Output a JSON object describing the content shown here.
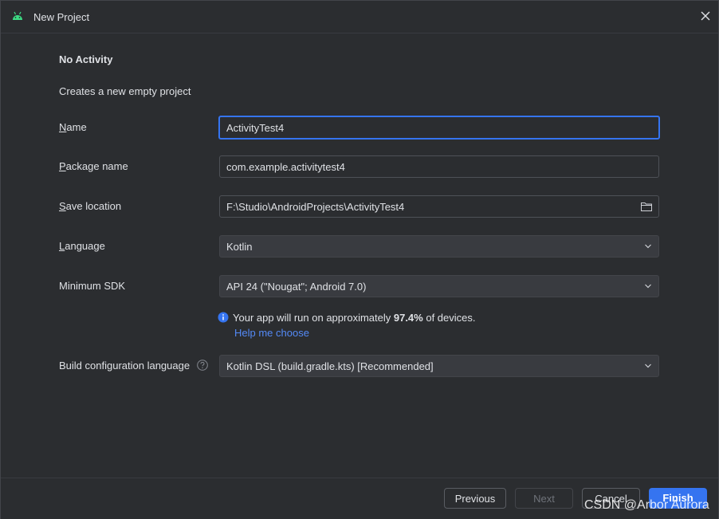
{
  "window": {
    "title": "New Project",
    "accent_color": "#3574f0",
    "background_color": "#2b2d30"
  },
  "page": {
    "heading": "No Activity",
    "subtitle": "Creates a new empty project"
  },
  "form": {
    "name": {
      "label_mnemonic": "N",
      "label_rest": "ame",
      "value": "ActivityTest4"
    },
    "package": {
      "label_mnemonic": "P",
      "label_rest": "ackage name",
      "value": "com.example.activitytest4"
    },
    "save_location": {
      "label_mnemonic": "S",
      "label_rest": "ave location",
      "value": "F:\\Studio\\AndroidProjects\\ActivityTest4",
      "icon": "folder-icon"
    },
    "language": {
      "label_mnemonic": "L",
      "label_rest": "anguage",
      "value": "Kotlin"
    },
    "min_sdk": {
      "label": "Minimum SDK",
      "value": "API 24 (\"Nougat\"; Android 7.0)"
    },
    "sdk_info": {
      "prefix": "Your app will run on approximately ",
      "percent": "97.4%",
      "suffix": " of devices.",
      "link": "Help me choose"
    },
    "build_config": {
      "label": "Build configuration language",
      "value": "Kotlin DSL (build.gradle.kts) [Recommended]"
    }
  },
  "footer": {
    "previous": "Previous",
    "next": "Next",
    "cancel": "Cancel",
    "finish": "Finish"
  },
  "watermark": "CSDN @Arbor Aurora"
}
